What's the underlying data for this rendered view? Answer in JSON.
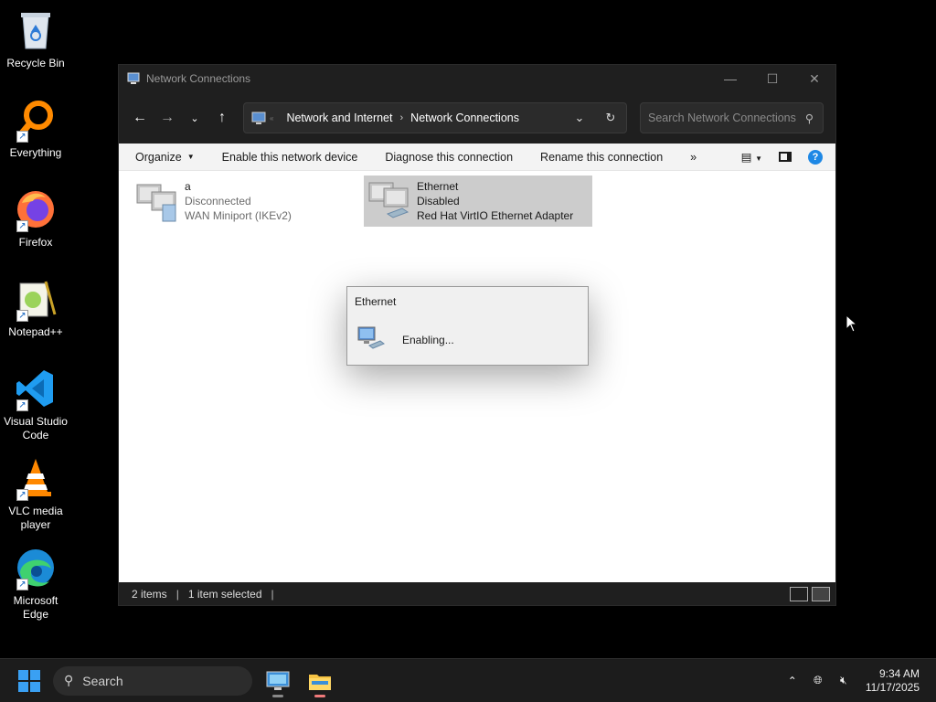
{
  "desktop": {
    "icons": [
      {
        "label": "Recycle Bin",
        "icon": "recycle-bin-icon"
      },
      {
        "label": "Everything",
        "icon": "everything-icon"
      },
      {
        "label": "Firefox",
        "icon": "firefox-icon"
      },
      {
        "label": "Notepad++",
        "icon": "notepadpp-icon"
      },
      {
        "label": "Visual Studio Code",
        "icon": "vscode-icon"
      },
      {
        "label": "VLC media player",
        "icon": "vlc-icon"
      },
      {
        "label": "Microsoft Edge",
        "icon": "edge-icon"
      }
    ]
  },
  "window": {
    "title": "Network Connections",
    "breadcrumb": [
      "Network and Internet",
      "Network Connections"
    ],
    "search_placeholder": "Search Network Connections",
    "commands": {
      "organize": "Organize",
      "enable": "Enable this network device",
      "diagnose": "Diagnose this connection",
      "rename": "Rename this connection",
      "more": "»"
    },
    "connections": [
      {
        "name": "a",
        "status": "Disconnected",
        "adapter": "WAN Miniport (IKEv2)",
        "selected": false
      },
      {
        "name": "Ethernet",
        "status": "Disabled",
        "adapter": "Red Hat VirtIO Ethernet Adapter",
        "selected": true
      }
    ],
    "status": {
      "items": "2 items",
      "selected": "1 item selected"
    }
  },
  "dialog": {
    "title": "Ethernet",
    "message": "Enabling..."
  },
  "taskbar": {
    "search_label": "Search",
    "time": "9:34 AM",
    "date": "11/17/2025"
  },
  "colors": {
    "accent": "#1e88e5",
    "titlebar": "#1f1f1f",
    "selected_item": "#cccccc"
  }
}
